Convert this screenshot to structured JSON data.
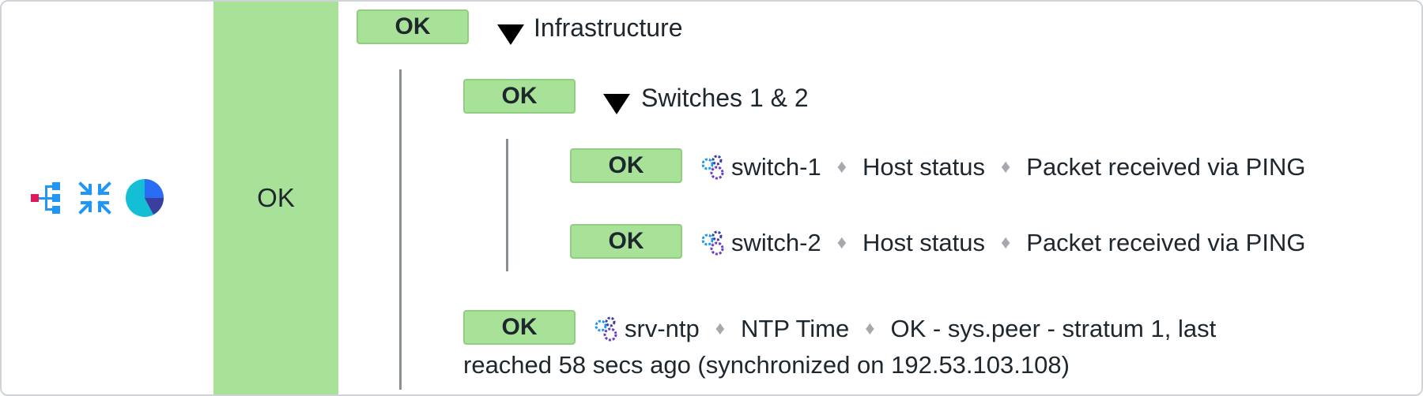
{
  "icons": {
    "tree": "tree-structure-icon",
    "collapse": "collapse-arrows-icon",
    "pie": "pie-chart-icon"
  },
  "aggregation": {
    "state_label": "OK"
  },
  "tree": {
    "root": {
      "state": "OK",
      "title": "Infrastructure"
    },
    "group": {
      "state": "OK",
      "title": "Switches 1 & 2"
    },
    "switch1": {
      "state": "OK",
      "host": "switch-1",
      "service": "Host status",
      "output": "Packet received via PING"
    },
    "switch2": {
      "state": "OK",
      "host": "switch-2",
      "service": "Host status",
      "output": "Packet received via PING"
    },
    "ntp": {
      "state": "OK",
      "host": "srv-ntp",
      "service": "NTP Time",
      "output_line1": "OK - sys.peer - stratum 1, last",
      "output_line2": "reached 58 secs ago (synchronized on 192.53.103.108)"
    },
    "separator": "♦"
  },
  "colors": {
    "ok": "#a8e298",
    "accent": "#2196f3",
    "red": "#e0175a"
  }
}
